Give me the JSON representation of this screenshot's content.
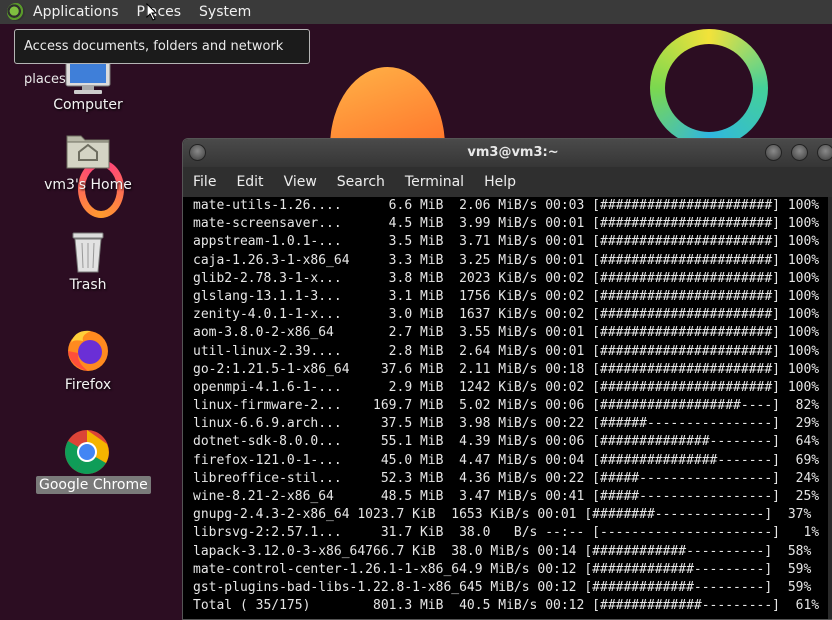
{
  "panel": {
    "items": [
      "Applications",
      "Places",
      "System"
    ]
  },
  "tooltip": {
    "text": "Access documents, folders and network places"
  },
  "desktop": {
    "icons": [
      {
        "label": "Computer"
      },
      {
        "label": "vm3's Home"
      },
      {
        "label": "Trash"
      },
      {
        "label": "Firefox"
      },
      {
        "label": "Google Chrome"
      }
    ]
  },
  "terminal": {
    "title": "vm3@vm3:~",
    "menu": [
      "File",
      "Edit",
      "View",
      "Search",
      "Terminal",
      "Help"
    ],
    "lines": [
      "mate-utils-1.26....      6.6 MiB  2.06 MiB/s 00:03 [######################] 100%",
      "mate-screensaver...      4.5 MiB  3.99 MiB/s 00:01 [######################] 100%",
      "appstream-1.0.1-...      3.5 MiB  3.71 MiB/s 00:01 [######################] 100%",
      "caja-1.26.3-1-x86_64     3.3 MiB  3.25 MiB/s 00:01 [######################] 100%",
      "glib2-2.78.3-1-x...      3.8 MiB  2023 KiB/s 00:02 [######################] 100%",
      "glslang-13.1.1-3...      3.1 MiB  1756 KiB/s 00:02 [######################] 100%",
      "zenity-4.0.1-1-x...      3.0 MiB  1637 KiB/s 00:02 [######################] 100%",
      "aom-3.8.0-2-x86_64       2.7 MiB  3.55 MiB/s 00:01 [######################] 100%",
      "util-linux-2.39....      2.8 MiB  2.64 MiB/s 00:01 [######################] 100%",
      "go-2:1.21.5-1-x86_64    37.6 MiB  2.11 MiB/s 00:18 [######################] 100%",
      "openmpi-4.1.6-1-...      2.9 MiB  1242 KiB/s 00:02 [######################] 100%",
      "linux-firmware-2...    169.7 MiB  5.02 MiB/s 00:06 [##################----]  82%",
      "linux-6.6.9.arch...     37.5 MiB  3.98 MiB/s 00:22 [######----------------]  29%",
      "dotnet-sdk-8.0.0...     55.1 MiB  4.39 MiB/s 00:06 [##############--------]  64%",
      "firefox-121.0-1-...     45.0 MiB  4.47 MiB/s 00:04 [###############-------]  69%",
      "libreoffice-stil...     52.3 MiB  4.36 MiB/s 00:22 [#####-----------------]  24%",
      "wine-8.21-2-x86_64      48.5 MiB  3.47 MiB/s 00:41 [#####-----------------]  25%",
      "gnupg-2.4.3-2-x86_64 1023.7 KiB  1653 KiB/s 00:01 [########--------------]  37%",
      "librsvg-2:2.57.1...     31.7 KiB  38.0   B/s --:-- [----------------------]   1%",
      "lapack-3.12.0-3-x86_64766.7 KiB  38.0 MiB/s 00:14 [############----------]  58%",
      "mate-control-center-1.26.1-1-x86_64.9 MiB/s 00:12 [#############---------]  59%",
      "gst-plugins-bad-libs-1.22.8-1-x86_645 MiB/s 00:12 [#############---------]  59%",
      "Total ( 35/175)        801.3 MiB  40.5 MiB/s 00:12 [#############---------]  61%"
    ]
  },
  "colors": {
    "desktop_bg": "#2c0d22",
    "panel_bg": "#3a3a3a",
    "terminal_bg": "#000000",
    "terminal_text": "#e6e6e6"
  }
}
